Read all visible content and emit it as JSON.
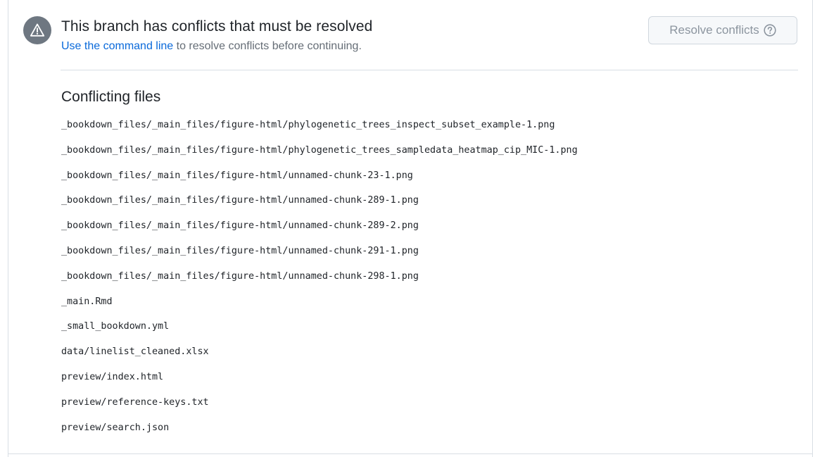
{
  "merge_status": {
    "icon": "alert-triangle-icon",
    "title": "This branch has conflicts that must be resolved",
    "subtitle_link": "Use the command line",
    "subtitle_rest": " to resolve conflicts before continuing.",
    "resolve_button": {
      "label": "Resolve conflicts",
      "icon": "question-circle-icon",
      "disabled": true
    }
  },
  "conflicts": {
    "heading": "Conflicting files",
    "files": [
      "_bookdown_files/_main_files/figure-html/phylogenetic_trees_inspect_subset_example-1.png",
      "_bookdown_files/_main_files/figure-html/phylogenetic_trees_sampledata_heatmap_cip_MIC-1.png",
      "_bookdown_files/_main_files/figure-html/unnamed-chunk-23-1.png",
      "_bookdown_files/_main_files/figure-html/unnamed-chunk-289-1.png",
      "_bookdown_files/_main_files/figure-html/unnamed-chunk-289-2.png",
      "_bookdown_files/_main_files/figure-html/unnamed-chunk-291-1.png",
      "_bookdown_files/_main_files/figure-html/unnamed-chunk-298-1.png",
      "_main.Rmd",
      "_small_bookdown.yml",
      "data/linelist_cleaned.xlsx",
      "preview/index.html",
      "preview/reference-keys.txt",
      "preview/search.json"
    ]
  },
  "colors": {
    "icon_bg": "#6e7781",
    "link": "#0969da",
    "muted_text": "#656d76",
    "disabled_text": "#8c959f",
    "border": "#d8dee4"
  }
}
